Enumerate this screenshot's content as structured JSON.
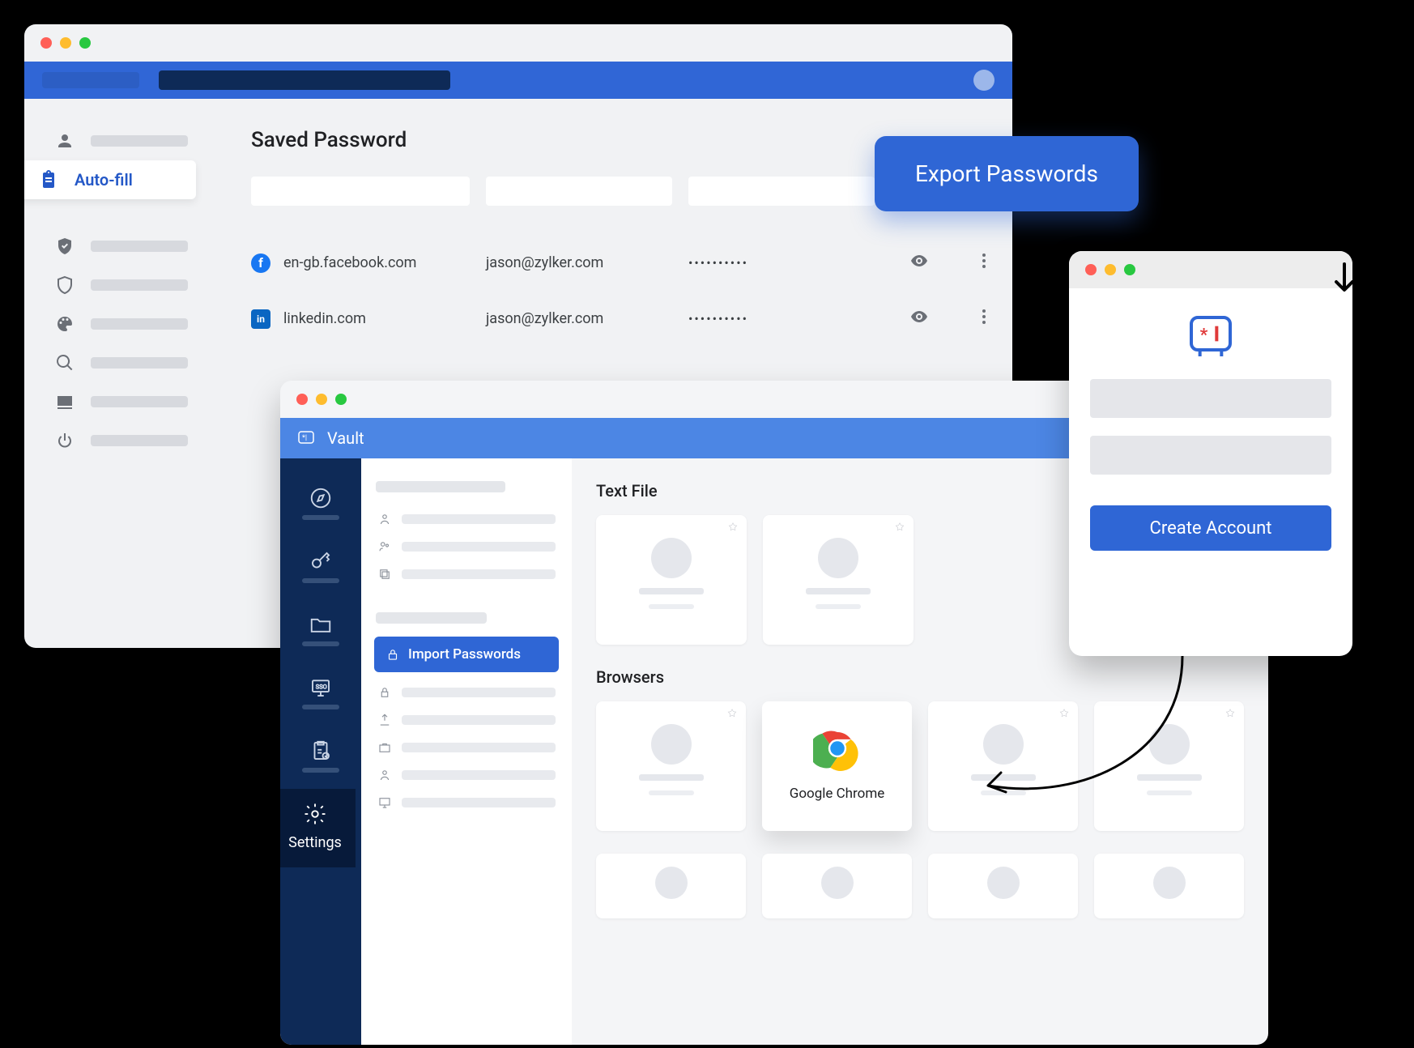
{
  "export_pill": {
    "label": "Export Passwords"
  },
  "browser_window": {
    "sidebar": {
      "active_label": "Auto-fill"
    },
    "content": {
      "heading": "Saved Password",
      "rows": [
        {
          "favicon_bg": "#1877f2",
          "favicon_text": "f",
          "site": "en-gb.facebook.com",
          "user": "jason@zylker.com",
          "password_mask": "••••••••••"
        },
        {
          "favicon_bg": "#0a66c2",
          "favicon_text": "in",
          "site": "linkedin.com",
          "user": "jason@zylker.com",
          "password_mask": "••••••••••"
        }
      ]
    }
  },
  "vault_window": {
    "title": "Vault",
    "nav": {
      "active_label": "Settings"
    },
    "subnav": {
      "primary_action": "Import Passwords"
    },
    "sections": {
      "text": {
        "heading": "Text File"
      },
      "browsers": {
        "heading": "Browsers",
        "featured": {
          "name": "Google Chrome"
        }
      }
    }
  },
  "signup_window": {
    "cta": "Create Account"
  }
}
